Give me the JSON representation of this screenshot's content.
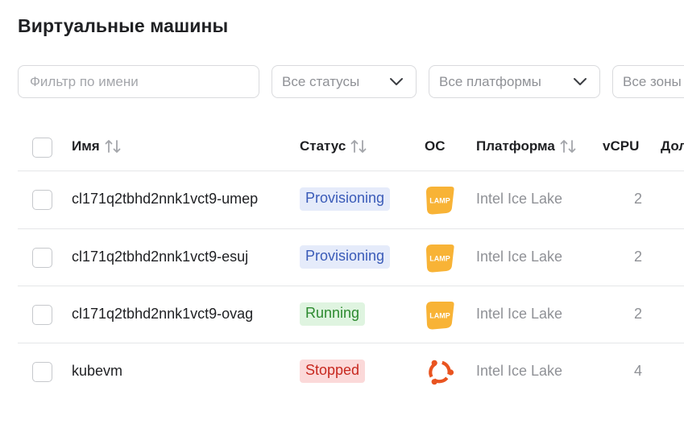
{
  "page": {
    "title": "Виртуальные машины"
  },
  "filters": {
    "name_placeholder": "Фильтр по имени",
    "status_label": "Все статусы",
    "platform_label": "Все платформы",
    "zone_label": "Все зоны"
  },
  "table": {
    "columns": {
      "name": "Имя",
      "status": "Статус",
      "os": "ОС",
      "platform": "Платформа",
      "vcpu": "vCPU",
      "next": "Доля"
    },
    "rows": [
      {
        "name": "cl171q2tbhd2nnk1vct9-umep",
        "status": "Provisioning",
        "status_kind": "provisioning",
        "os_icon": "lamp-icon",
        "os_label": "LAMP",
        "platform": "Intel Ice Lake",
        "vcpu": "2"
      },
      {
        "name": "cl171q2tbhd2nnk1vct9-esuj",
        "status": "Provisioning",
        "status_kind": "provisioning",
        "os_icon": "lamp-icon",
        "os_label": "LAMP",
        "platform": "Intel Ice Lake",
        "vcpu": "2"
      },
      {
        "name": "cl171q2tbhd2nnk1vct9-ovag",
        "status": "Running",
        "status_kind": "running",
        "os_icon": "lamp-icon",
        "os_label": "LAMP",
        "platform": "Intel Ice Lake",
        "vcpu": "2"
      },
      {
        "name": "kubevm",
        "status": "Stopped",
        "status_kind": "stopped",
        "os_icon": "ubuntu-icon",
        "platform": "Intel Ice Lake",
        "vcpu": "4"
      }
    ]
  },
  "colors": {
    "provisioning_bg": "#e5ebfa",
    "provisioning_fg": "#3a5bb8",
    "running_bg": "#dff4e0",
    "running_fg": "#2c8a2f",
    "stopped_bg": "#fbd9d9",
    "stopped_fg": "#c7281f",
    "lamp_orange": "#f8b336",
    "ubuntu_orange": "#e95420"
  }
}
